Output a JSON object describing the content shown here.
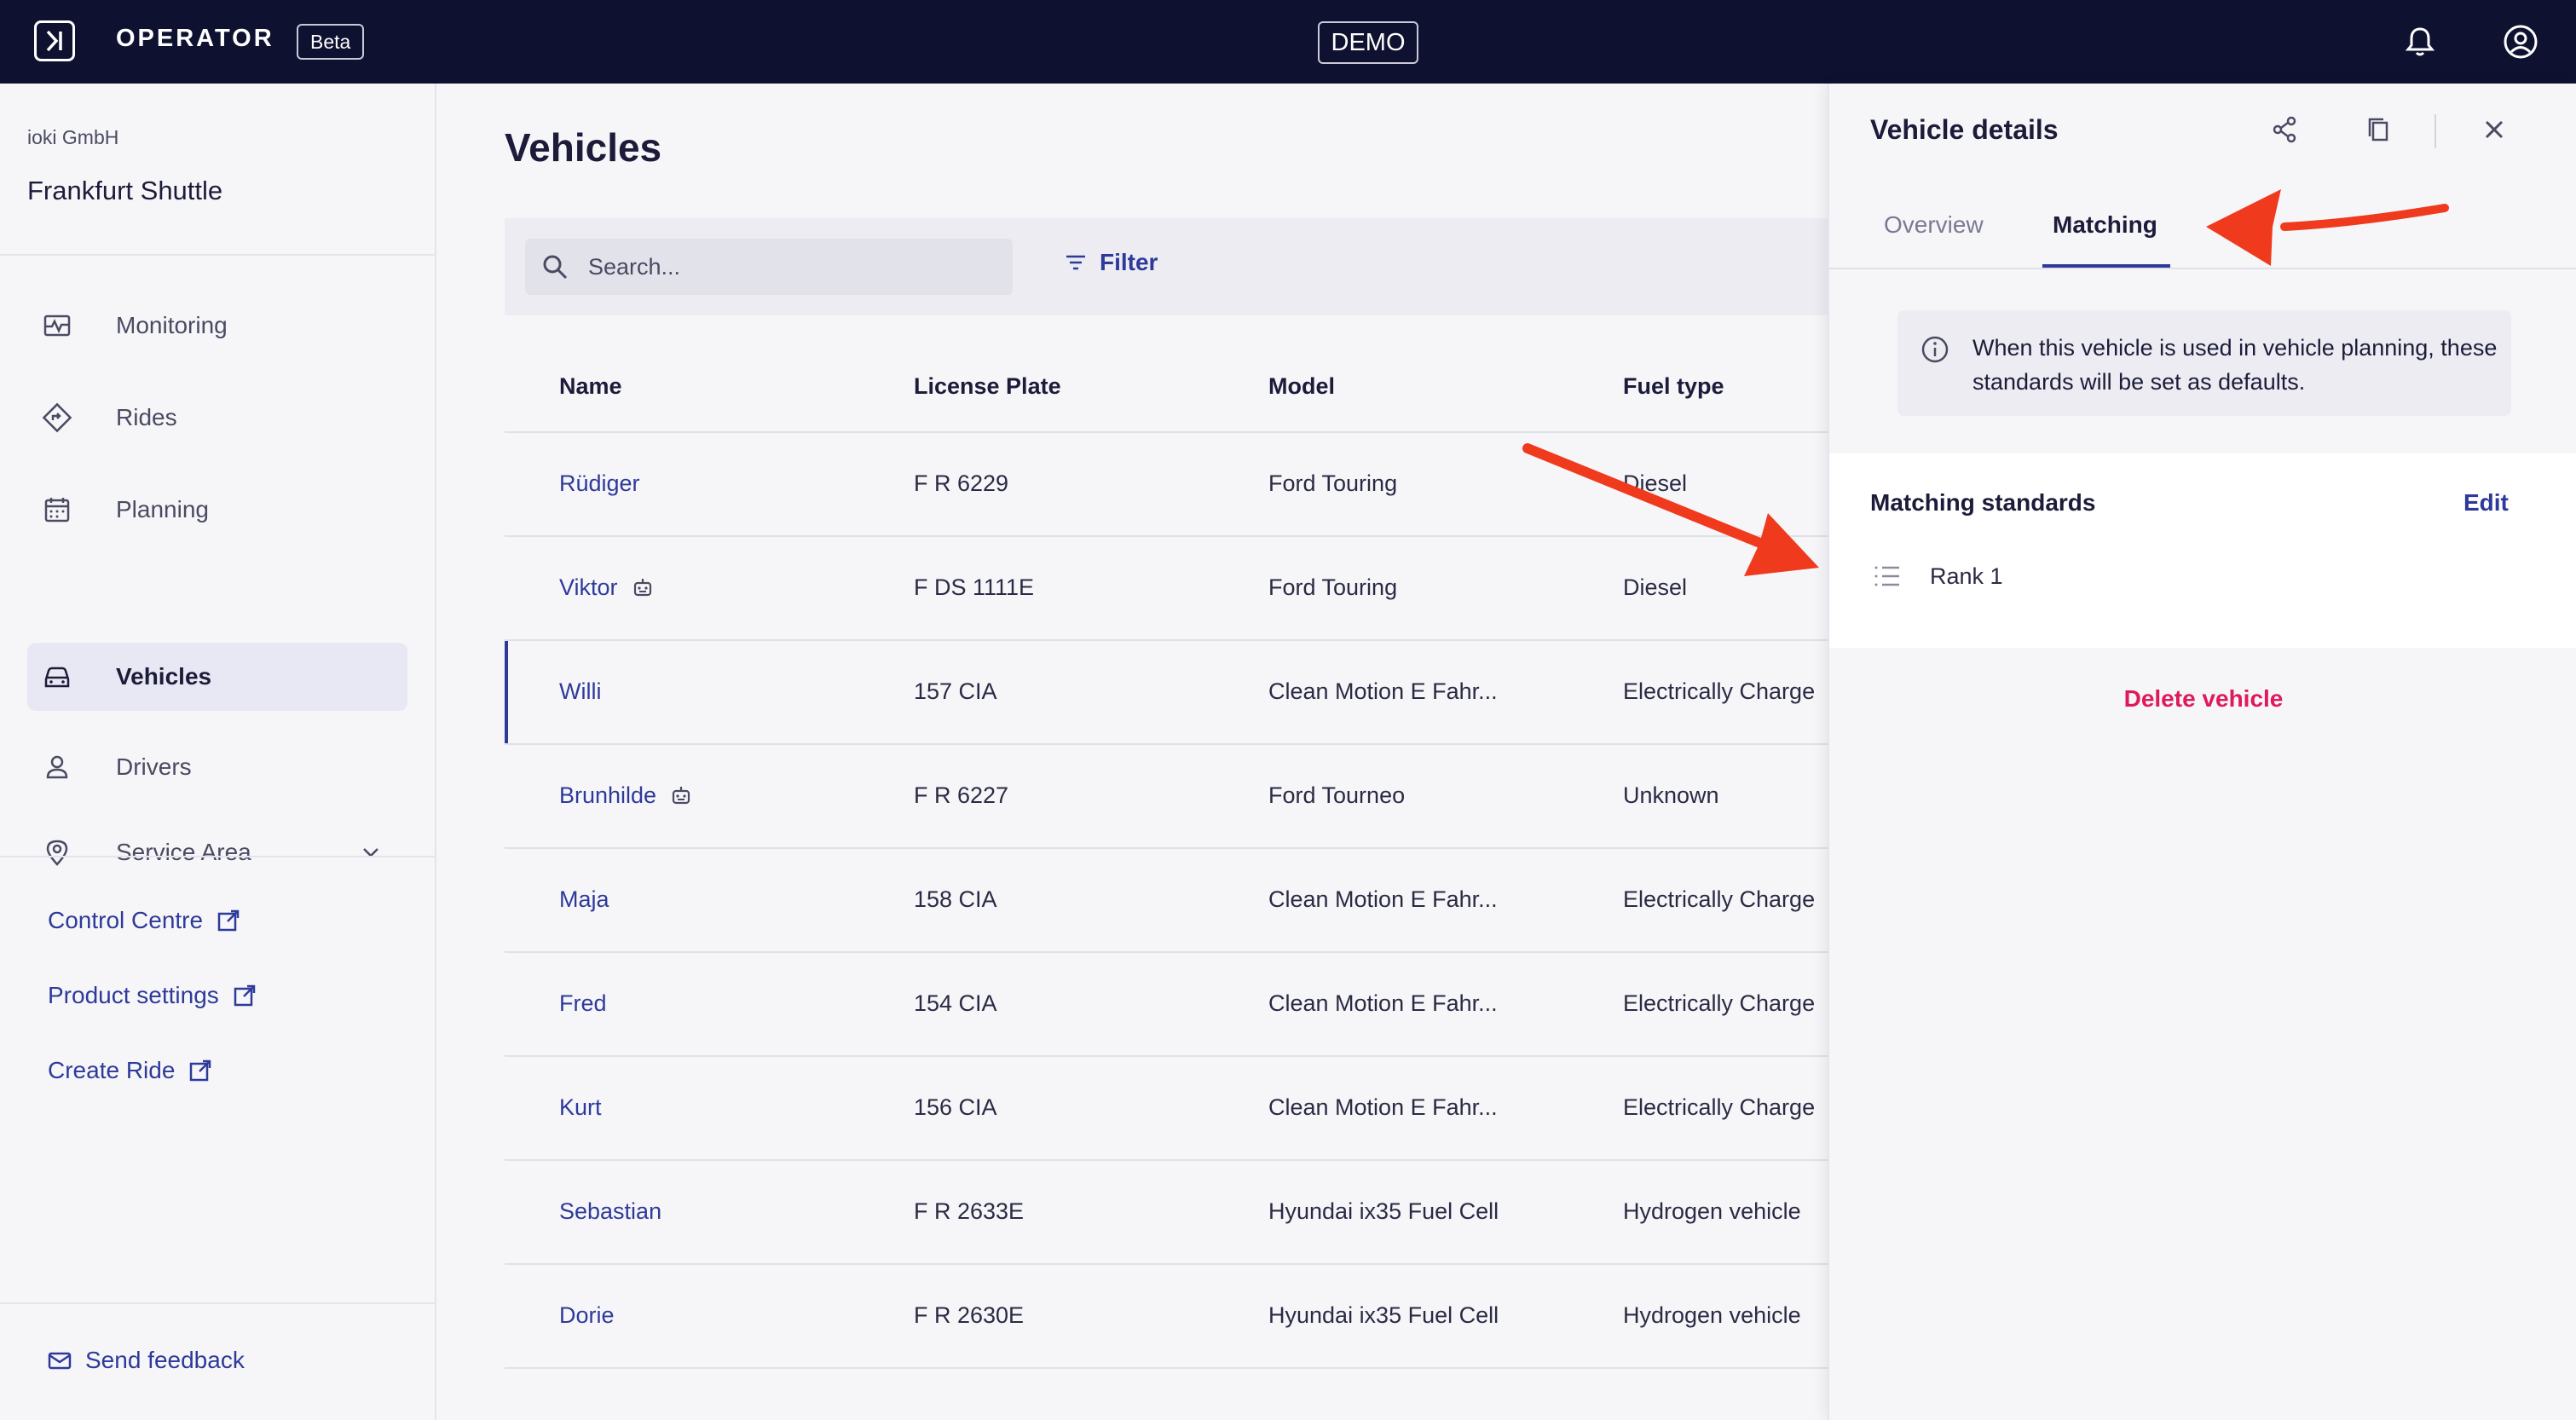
{
  "topbar": {
    "brand": "OPERATOR",
    "beta": "Beta",
    "demo": "DEMO",
    "icons": [
      "bell-icon",
      "user-account-icon"
    ]
  },
  "sidebar": {
    "org": "ioki GmbH",
    "project": "Frankfurt Shuttle",
    "nav": [
      {
        "label": "Monitoring",
        "icon": "monitoring-icon"
      },
      {
        "label": "Rides",
        "icon": "route-icon"
      },
      {
        "label": "Planning",
        "icon": "calendar-icon"
      },
      {
        "label": "Vehicles",
        "icon": "car-icon",
        "active": true
      },
      {
        "label": "Drivers",
        "icon": "person-icon"
      },
      {
        "label": "Service Area",
        "icon": "location-pin-icon",
        "expandable": true
      }
    ],
    "links": [
      {
        "label": "Control Centre"
      },
      {
        "label": "Product settings"
      },
      {
        "label": "Create Ride"
      }
    ],
    "feedback": "Send feedback"
  },
  "main": {
    "title": "Vehicles",
    "search_placeholder": "Search...",
    "filter_label": "Filter",
    "columns": [
      "Name",
      "License Plate",
      "Model",
      "Fuel type"
    ],
    "rows": [
      {
        "name": "Rüdiger",
        "plate": "F R 6229",
        "model": "Ford Touring",
        "fuel": "Diesel",
        "autonomous": false
      },
      {
        "name": "Viktor",
        "plate": "F DS 1111E",
        "model": "Ford Touring",
        "fuel": "Diesel",
        "autonomous": true
      },
      {
        "name": "Willi",
        "plate": "157 CIA",
        "model": "Clean Motion E Fahr...",
        "fuel": "Electrically Charge",
        "autonomous": false,
        "selected": true
      },
      {
        "name": "Brunhilde",
        "plate": "F R 6227",
        "model": "Ford Tourneo",
        "fuel": "Unknown",
        "autonomous": true
      },
      {
        "name": "Maja",
        "plate": "158 CIA",
        "model": "Clean Motion E Fahr...",
        "fuel": "Electrically Charge",
        "autonomous": false
      },
      {
        "name": "Fred",
        "plate": "154 CIA",
        "model": "Clean Motion E Fahr...",
        "fuel": "Electrically Charge",
        "autonomous": false
      },
      {
        "name": "Kurt",
        "plate": "156 CIA",
        "model": "Clean Motion E Fahr...",
        "fuel": "Electrically Charge",
        "autonomous": false
      },
      {
        "name": "Sebastian",
        "plate": "F R 2633E",
        "model": "Hyundai ix35 Fuel Cell",
        "fuel": "Hydrogen vehicle",
        "autonomous": false
      },
      {
        "name": "Dorie",
        "plate": "F R 2630E",
        "model": "Hyundai ix35 Fuel Cell",
        "fuel": "Hydrogen vehicle",
        "autonomous": false
      }
    ]
  },
  "panel": {
    "title": "Vehicle details",
    "tabs": [
      "Overview",
      "Matching"
    ],
    "active_tab": "Matching",
    "info_text": "When this vehicle is used in vehicle planning, these standards will be set as defaults.",
    "standards_title": "Matching standards",
    "edit_label": "Edit",
    "standards": [
      "Rank 1"
    ],
    "delete_label": "Delete vehicle"
  },
  "colors": {
    "topbar": "#0f1131",
    "accent": "#2e3a9a",
    "danger": "#e0195a",
    "annotation_arrow": "#f03a1e"
  }
}
